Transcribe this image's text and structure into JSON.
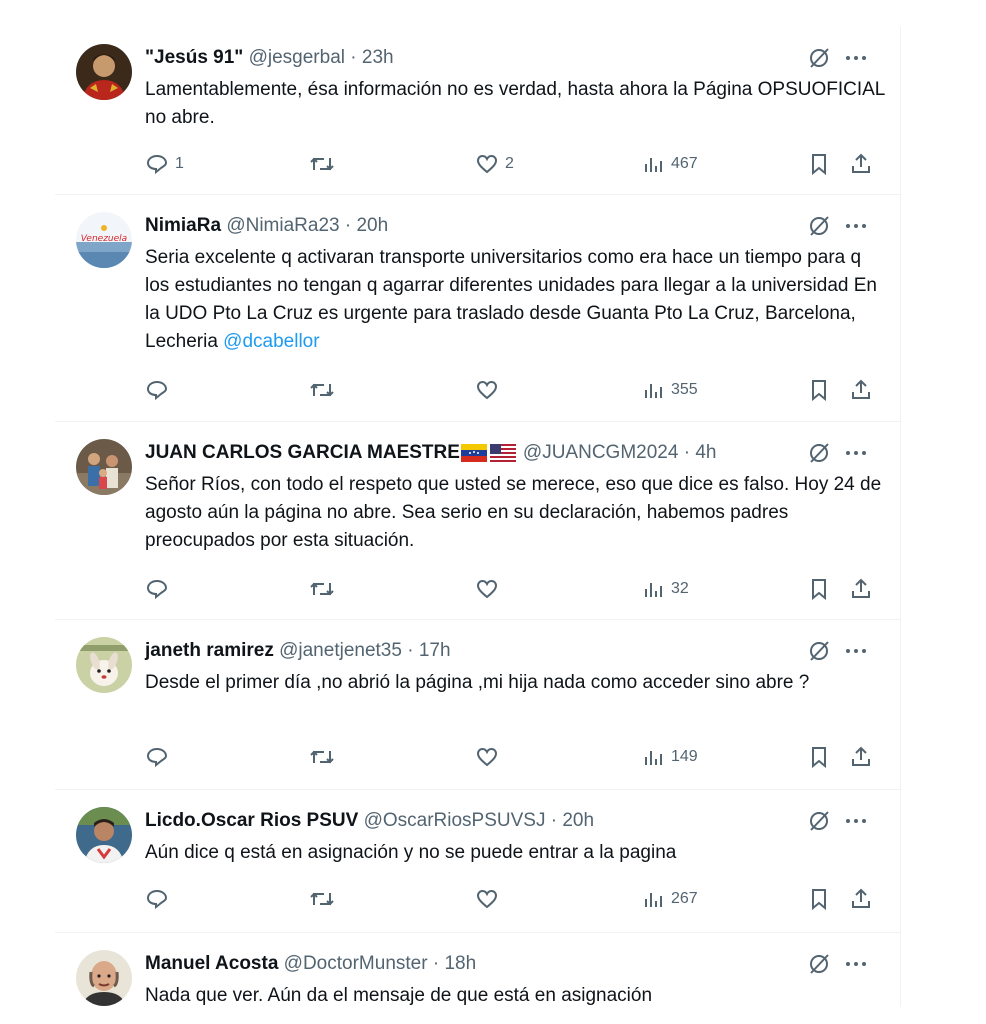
{
  "tweets": [
    {
      "name": "\"Jesús 91\"",
      "handle": "@jesgerbal",
      "time": "23h",
      "text": "Lamentablemente, ésa información no es verdad, hasta ahora la Página OPSUOFICIAL no abre.",
      "replies": "1",
      "likes": "2",
      "views": "467",
      "avatar_icon": "portrait-avatar"
    },
    {
      "name": "NimiaRa",
      "handle": "@NimiaRa23",
      "time": "20h",
      "text": "Seria excelente q activaran transporte universitarios como era hace un tiempo para q los estudiantes no tengan q agarrar diferentes unidades para llegar a la universidad En la UDO Pto La Cruz es urgente para traslado desde Guanta Pto La Cruz, Barcelona, Lecheria",
      "mention": "@dcabellor",
      "replies": "",
      "likes": "",
      "views": "355",
      "avatar_icon": "venezuela-logo-avatar"
    },
    {
      "name": "JUAN CARLOS GARCIA MAESTRE",
      "handle": "@JUANCGM2024",
      "time": "4h",
      "text": "Señor Ríos, con todo el respeto que usted se merece, eso que dice es falso. Hoy 24 de agosto aún la página no abre. Sea serio en su declaración, habemos padres preocupados por esta situación.",
      "replies": "",
      "likes": "",
      "views": "32",
      "avatar_icon": "family-photo-avatar",
      "flag_icons": [
        "venezuela-flag-icon",
        "usa-flag-icon"
      ]
    },
    {
      "name": "janeth ramirez",
      "handle": "@janetjenet35",
      "time": "17h",
      "text": "Desde el primer día ,no abrió la página ,mi hija nada como acceder sino abre ?",
      "replies": "",
      "likes": "",
      "views": "149",
      "avatar_icon": "cartoon-dog-avatar"
    },
    {
      "name": "Licdo.Oscar Rios PSUV",
      "handle": "@OscarRiosPSUVSJ",
      "time": "20h",
      "text": "Aún dice q está en asignación y no se puede entrar a la pagina",
      "replies": "",
      "likes": "",
      "views": "267",
      "avatar_icon": "man-portrait-avatar"
    },
    {
      "name": "Manuel Acosta",
      "handle": "@DoctorMunster",
      "time": "18h",
      "text": "Nada que ver. Aún da el mensaje de que  está en asignación",
      "avatar_icon": "bald-man-avatar"
    }
  ],
  "dot": "·",
  "colors": {
    "text": "#0f1419",
    "secondary": "#536471",
    "link": "#1d9bf0",
    "border": "#eff3f4"
  }
}
